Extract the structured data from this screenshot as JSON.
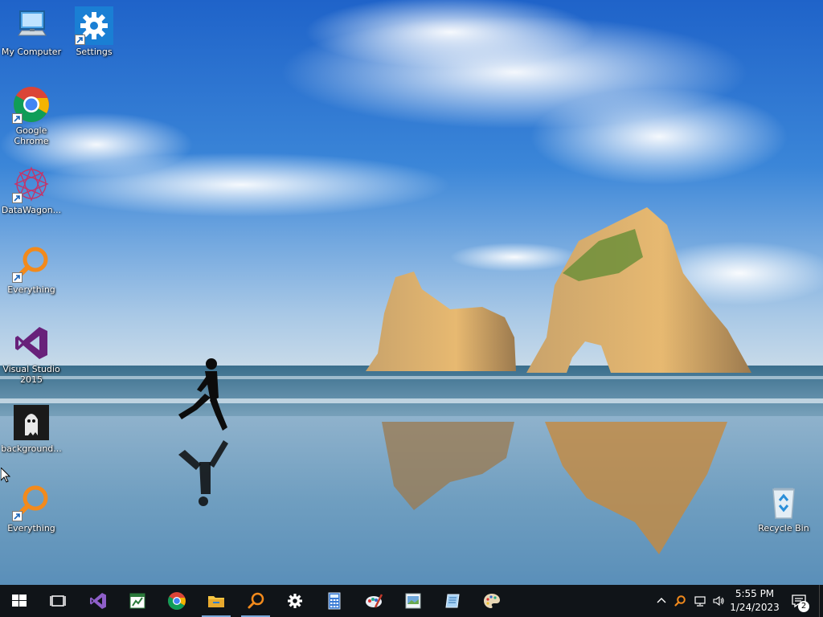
{
  "desktop": {
    "icons": [
      {
        "label": "My Computer",
        "icon": "my-computer-icon"
      },
      {
        "label": "Settings",
        "icon": "gear-icon"
      },
      {
        "label": "Google Chrome",
        "icon": "chrome-icon"
      },
      {
        "label": "DataWagon...",
        "icon": "datawagon-icon"
      },
      {
        "label": "Everything",
        "icon": "everything-icon"
      },
      {
        "label": "Visual Studio 2015",
        "icon": "visual-studio-icon"
      },
      {
        "label": "background...",
        "icon": "ghost-image-icon"
      },
      {
        "label": "Everything",
        "icon": "everything-icon"
      },
      {
        "label": "Recycle Bin",
        "icon": "recycle-bin-icon"
      }
    ]
  },
  "taskbar": {
    "pinned": [
      "windows-start-icon",
      "task-view-icon",
      "visual-studio-icon",
      "spreadsheet-icon",
      "chrome-icon",
      "file-explorer-icon",
      "everything-icon",
      "gear-icon",
      "calculator-icon",
      "paint-brush-icon",
      "image-viewer-icon",
      "notepad-icon",
      "palette-icon"
    ],
    "tray": {
      "icons": [
        "chevron-up-icon",
        "everything-tray-icon",
        "network-icon",
        "volume-icon"
      ],
      "time": "5:55 PM",
      "date": "1/24/2023",
      "notification_count": "2"
    }
  },
  "colors": {
    "taskbar": "#101418",
    "accent": "#7aa7d8"
  }
}
